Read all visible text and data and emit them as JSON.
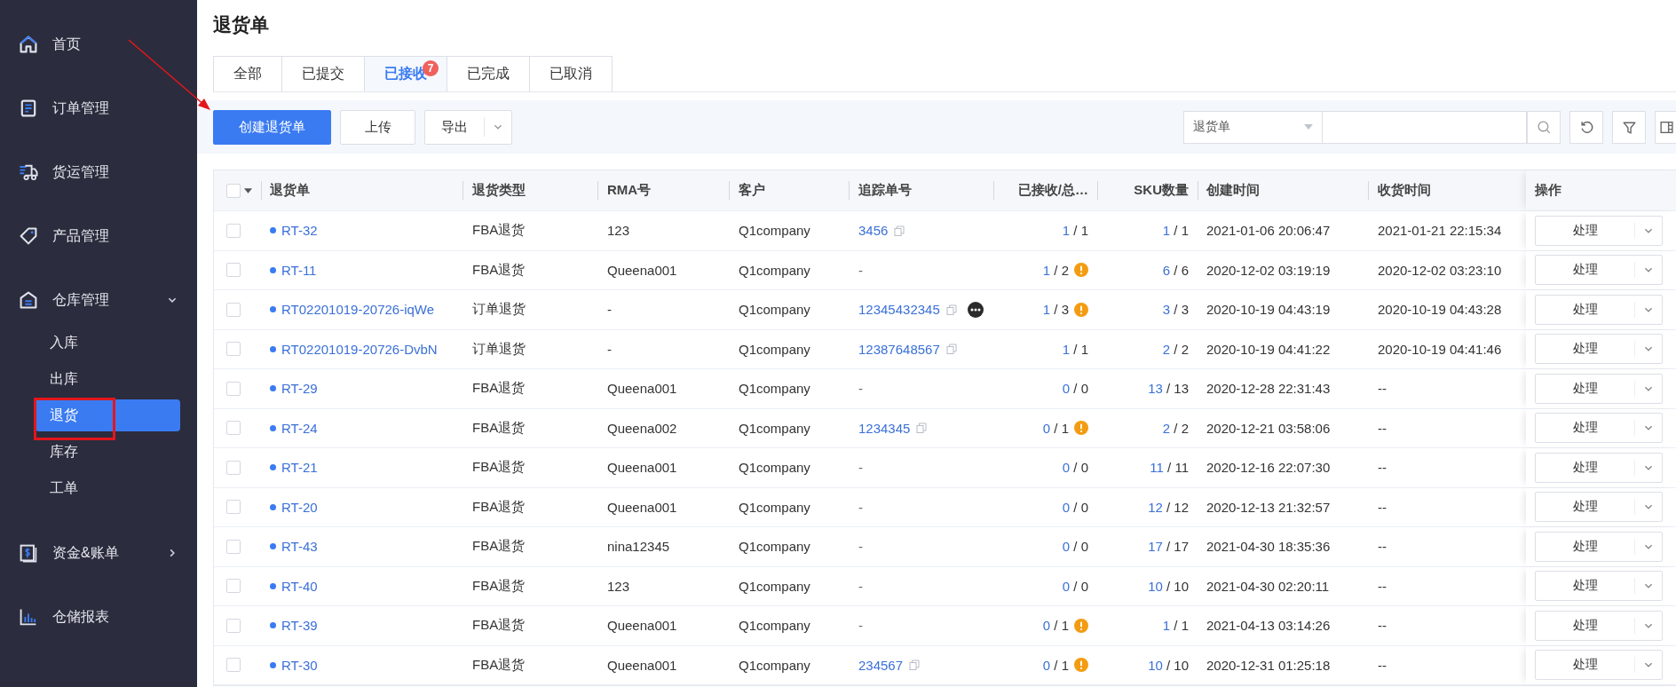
{
  "sidebar": {
    "items": [
      {
        "label": "首页"
      },
      {
        "label": "订单管理"
      },
      {
        "label": "货运管理"
      },
      {
        "label": "产品管理"
      },
      {
        "label": "仓库管理",
        "expanded": true,
        "children": [
          {
            "label": "入库",
            "selected": false
          },
          {
            "label": "出库",
            "selected": false
          },
          {
            "label": "退货",
            "selected": true
          },
          {
            "label": "库存",
            "selected": false
          },
          {
            "label": "工单",
            "selected": false
          }
        ]
      },
      {
        "label": "资金&账单",
        "expanded": false
      },
      {
        "label": "仓储报表"
      }
    ]
  },
  "page": {
    "title": "退货单"
  },
  "tabs": [
    {
      "label": "全部",
      "selected": false
    },
    {
      "label": "已提交",
      "selected": false
    },
    {
      "label": "已接收",
      "selected": true,
      "badge": "7"
    },
    {
      "label": "已完成",
      "selected": false
    },
    {
      "label": "已取消",
      "selected": false
    }
  ],
  "toolbar": {
    "create_button": "创建退货单",
    "upload_button": "上传",
    "export_button": "导出",
    "search_scope": "退货单"
  },
  "table": {
    "select_all_checked": false,
    "columns": [
      "退货单",
      "退货类型",
      "RMA号",
      "客户",
      "追踪单号",
      "已接收/总…",
      "SKU数量",
      "创建时间",
      "收货时间",
      "操作"
    ],
    "rows": [
      {
        "id": "RT-32",
        "checked": false,
        "type": "FBA退货",
        "rma": "123",
        "customer": "Q1company",
        "tracking": "3456",
        "copyable": true,
        "more": false,
        "received": "1",
        "received_total": "/ 1",
        "warning": false,
        "sku": "1",
        "sku_total": "/ 1",
        "created": "2021-01-06 20:06:47",
        "received_time": "2021-01-21 22:15:34",
        "action": "处理"
      },
      {
        "id": "RT-11",
        "checked": false,
        "type": "FBA退货",
        "rma": "Queena001",
        "customer": "Q1company",
        "tracking": "-",
        "copyable": false,
        "more": false,
        "received": "1",
        "received_total": "/ 2",
        "warning": true,
        "sku": "6",
        "sku_total": "/ 6",
        "created": "2020-12-02 03:19:19",
        "received_time": "2020-12-02 03:23:10",
        "action": "处理"
      },
      {
        "id": "RT02201019-20726-iqWe",
        "checked": false,
        "type": "订单退货",
        "rma": "-",
        "customer": "Q1company",
        "tracking": "12345432345",
        "copyable": true,
        "more": true,
        "received": "1",
        "received_total": "/ 3",
        "warning": true,
        "sku": "3",
        "sku_total": "/ 3",
        "created": "2020-10-19 04:43:19",
        "received_time": "2020-10-19 04:43:28",
        "action": "处理"
      },
      {
        "id": "RT02201019-20726-DvbN",
        "checked": false,
        "type": "订单退货",
        "rma": "-",
        "customer": "Q1company",
        "tracking": "12387648567",
        "copyable": true,
        "more": false,
        "received": "1",
        "received_total": "/ 1",
        "warning": false,
        "sku": "2",
        "sku_total": "/ 2",
        "created": "2020-10-19 04:41:22",
        "received_time": "2020-10-19 04:41:46",
        "action": "处理"
      },
      {
        "id": "RT-29",
        "checked": false,
        "type": "FBA退货",
        "rma": "Queena001",
        "customer": "Q1company",
        "tracking": "-",
        "copyable": false,
        "more": false,
        "received": "0",
        "received_total": "/ 0",
        "warning": false,
        "sku": "13",
        "sku_total": "/ 13",
        "created": "2020-12-28 22:31:43",
        "received_time": "--",
        "action": "处理"
      },
      {
        "id": "RT-24",
        "checked": false,
        "type": "FBA退货",
        "rma": "Queena002",
        "customer": "Q1company",
        "tracking": "1234345",
        "copyable": true,
        "more": false,
        "received": "0",
        "received_total": "/ 1",
        "warning": true,
        "sku": "2",
        "sku_total": "/ 2",
        "created": "2020-12-21 03:58:06",
        "received_time": "--",
        "action": "处理"
      },
      {
        "id": "RT-21",
        "checked": false,
        "type": "FBA退货",
        "rma": "Queena001",
        "customer": "Q1company",
        "tracking": "-",
        "copyable": false,
        "more": false,
        "received": "0",
        "received_total": "/ 0",
        "warning": false,
        "sku": "11",
        "sku_total": "/ 11",
        "created": "2020-12-16 22:07:30",
        "received_time": "--",
        "action": "处理"
      },
      {
        "id": "RT-20",
        "checked": false,
        "type": "FBA退货",
        "rma": "Queena001",
        "customer": "Q1company",
        "tracking": "-",
        "copyable": false,
        "more": false,
        "received": "0",
        "received_total": "/ 0",
        "warning": false,
        "sku": "12",
        "sku_total": "/ 12",
        "created": "2020-12-13 21:32:57",
        "received_time": "--",
        "action": "处理"
      },
      {
        "id": "RT-43",
        "checked": false,
        "type": "FBA退货",
        "rma": "nina12345",
        "customer": "Q1company",
        "tracking": "-",
        "copyable": false,
        "more": false,
        "received": "0",
        "received_total": "/ 0",
        "warning": false,
        "sku": "17",
        "sku_total": "/ 17",
        "created": "2021-04-30 18:35:36",
        "received_time": "--",
        "action": "处理"
      },
      {
        "id": "RT-40",
        "checked": false,
        "type": "FBA退货",
        "rma": "123",
        "customer": "Q1company",
        "tracking": "-",
        "copyable": false,
        "more": false,
        "received": "0",
        "received_total": "/ 0",
        "warning": false,
        "sku": "10",
        "sku_total": "/ 10",
        "created": "2021-04-30 02:20:11",
        "received_time": "--",
        "action": "处理"
      },
      {
        "id": "RT-39",
        "checked": false,
        "type": "FBA退货",
        "rma": "Queena001",
        "customer": "Q1company",
        "tracking": "-",
        "copyable": false,
        "more": false,
        "received": "0",
        "received_total": "/ 1",
        "warning": true,
        "sku": "1",
        "sku_total": "/ 1",
        "created": "2021-04-13 03:14:26",
        "received_time": "--",
        "action": "处理"
      },
      {
        "id": "RT-30",
        "checked": false,
        "type": "FBA退货",
        "rma": "Queena001",
        "customer": "Q1company",
        "tracking": "234567",
        "copyable": true,
        "more": false,
        "received": "0",
        "received_total": "/ 1",
        "warning": true,
        "sku": "10",
        "sku_total": "/ 10",
        "created": "2020-12-31 01:25:18",
        "received_time": "--",
        "action": "处理"
      }
    ]
  }
}
